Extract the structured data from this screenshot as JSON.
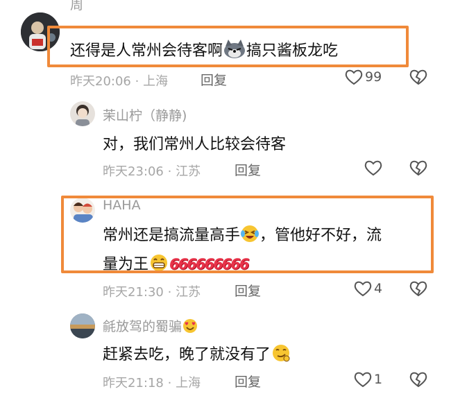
{
  "comments": [
    {
      "name": "周",
      "text_a": "还得是人常州会待客啊",
      "text_b": "搞只酱板龙吃",
      "time": "昨天20:06",
      "location": "上海",
      "reply": "回复",
      "likes": "99"
    },
    {
      "name": "茉山柠（静静)",
      "text": "对，我们常州人比较会待客",
      "time": "昨天23:06",
      "location": "江苏",
      "reply": "回复",
      "likes": ""
    },
    {
      "name": "HAHA",
      "text_a": "常州还是搞流量高手",
      "text_b": "，管他好不好，流",
      "text_c": "量为王",
      "text_d": "666666666",
      "time": "昨天21:30",
      "location": "江苏",
      "reply": "回复",
      "likes": "4"
    },
    {
      "name": "毹放驾的蜀骗",
      "text": "赶紧去吃，晚了就没有了",
      "time": "昨天21:18",
      "location": "上海",
      "reply": "回复",
      "likes": "1"
    }
  ],
  "separator": "·",
  "colors": {
    "highlight": "#f08a3a",
    "meta": "#a6a6a6",
    "name": "#9a9a9a"
  }
}
